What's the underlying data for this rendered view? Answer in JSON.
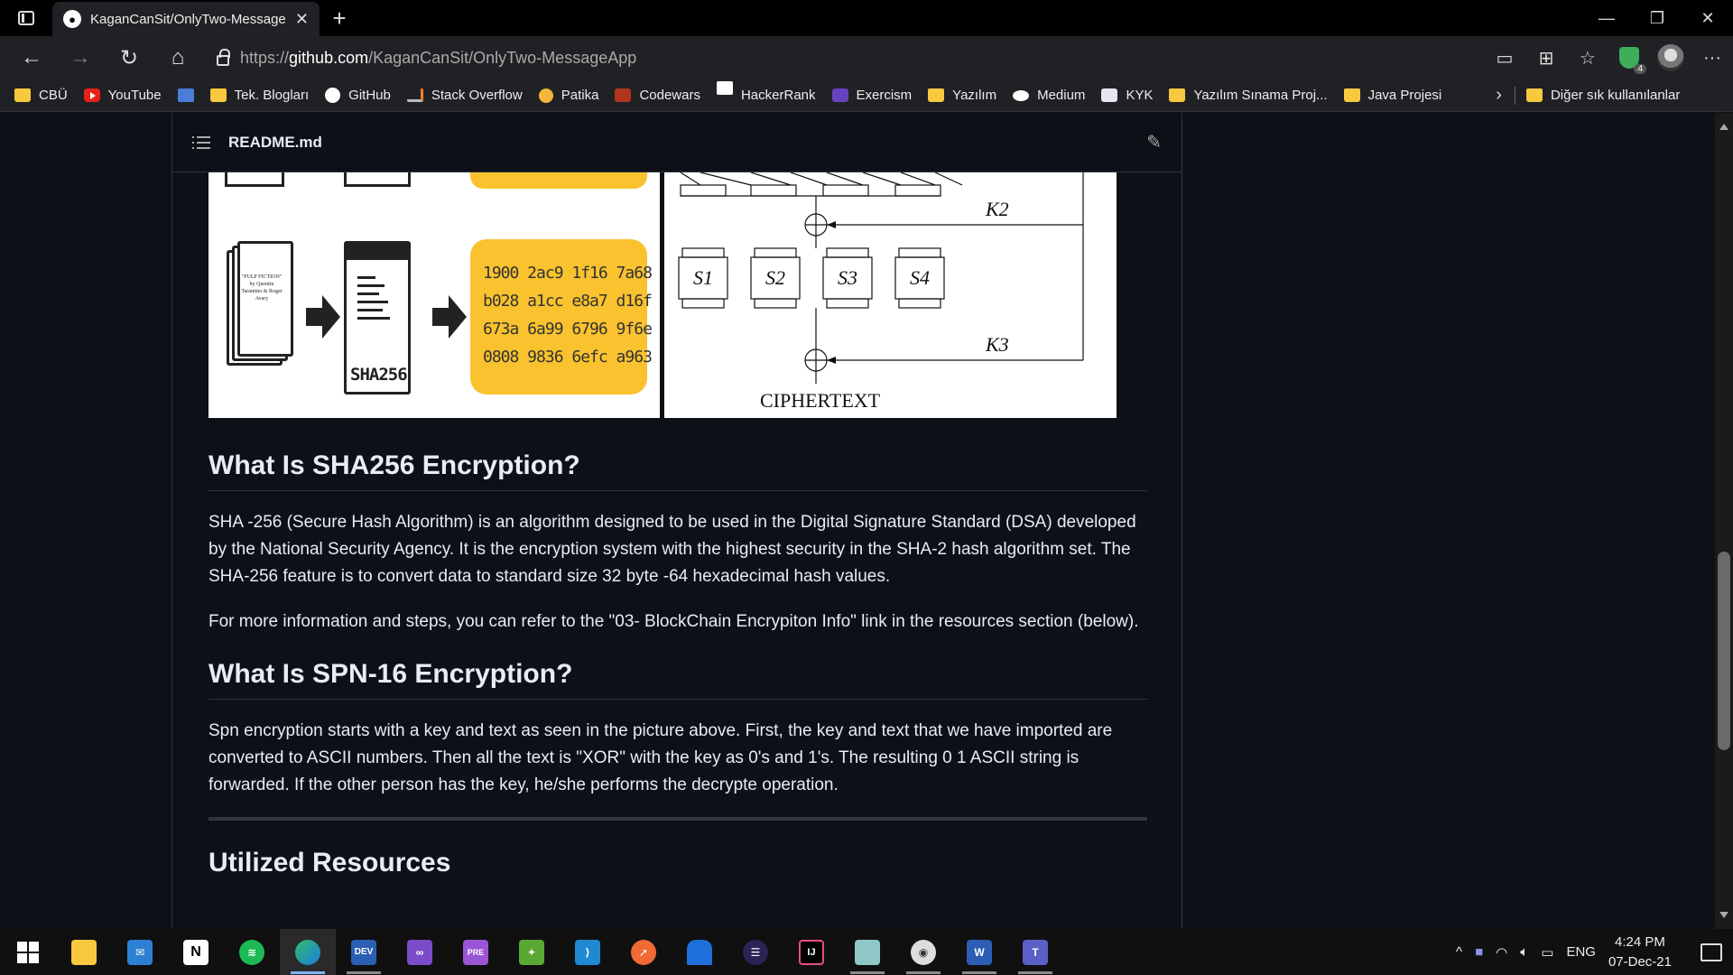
{
  "browser": {
    "tab_title": "KaganCanSit/OnlyTwo-MessageA",
    "url_prefix": "https://",
    "url_host": "github.com",
    "url_path": "/KaganCanSit/OnlyTwo-MessageApp",
    "bookmarks": [
      {
        "label": "CBÜ",
        "icon": "folder-icon"
      },
      {
        "label": "YouTube",
        "icon": "youtube-icon"
      },
      {
        "label": "",
        "icon": "translate-icon"
      },
      {
        "label": "Tek. Blogları",
        "icon": "folder-icon"
      },
      {
        "label": "GitHub",
        "icon": "github-icon"
      },
      {
        "label": "Stack Overflow",
        "icon": "stackoverflow-icon"
      },
      {
        "label": "Patika",
        "icon": "patika-icon"
      },
      {
        "label": "Codewars",
        "icon": "codewars-icon"
      },
      {
        "label": "HackerRank",
        "icon": "hackerrank-icon"
      },
      {
        "label": "Exercism",
        "icon": "exercism-icon"
      },
      {
        "label": "Yazılım",
        "icon": "folder-icon"
      },
      {
        "label": "Medium",
        "icon": "medium-icon"
      },
      {
        "label": "KYK",
        "icon": "kyk-icon"
      },
      {
        "label": "Yazılım Sınama Proj...",
        "icon": "folder-icon"
      },
      {
        "label": "Java Projesi",
        "icon": "folder-icon"
      }
    ],
    "other_bookmarks": "Diğer sık kullanılanlar",
    "extension_badge": "4"
  },
  "readme": {
    "filename": "README.md",
    "figure": {
      "doc_text": "\"PULP FICTION\" by Quentin Tarantino & Roger Avary",
      "sha_label": "SHA256",
      "hash_lines": [
        "1900 2ac9 1f16 7a68",
        "b028 a1cc e8a7 d16f",
        "673a 6a99 6796 9f6e",
        "0808 9836 6efc a963"
      ],
      "sboxes": [
        "S1",
        "S2",
        "S3",
        "S4"
      ],
      "key2": "K2",
      "key3": "K3",
      "ciphertext_label": "CIPHERTEXT"
    },
    "sections": {
      "sha_heading": "What Is SHA256 Encryption?",
      "sha_p1": "SHA -256 (Secure Hash Algorithm) is an algorithm designed to be used in the Digital Signature Standard (DSA) developed by the National Security Agency. It is the encryption system with the highest security in the SHA-2 hash algorithm set. The SHA-256 feature is to convert data to standard size 32 byte -64 hexadecimal hash values.",
      "sha_p2": "For more information and steps, you can refer to the \"03- BlockChain Encrypiton Info\" link in the resources section (below).",
      "spn_heading": "What Is SPN-16 Encryption?",
      "spn_p1": "Spn encryption starts with a key and text as seen in the picture above. First, the key and text that we have imported are converted to ASCII numbers. Then all the text is \"XOR\" with the key as 0's and 1's. The resulting 0 1 ASCII string is forwarded. If the other person has the key, he/she performs the decrypte operation.",
      "resources_heading": "Utilized Resources"
    }
  },
  "taskbar": {
    "apps": [
      "file-explorer",
      "mail",
      "notion",
      "spotify",
      "edge",
      "dev-home",
      "visual-studio",
      "visual-studio-preview",
      "excel-like",
      "vscode",
      "postman",
      "edge-dev",
      "eclipse",
      "intellij",
      "cloud-tool",
      "obs",
      "word",
      "teams"
    ],
    "language": "ENG",
    "time": "4:24 PM",
    "date": "07-Dec-21"
  }
}
